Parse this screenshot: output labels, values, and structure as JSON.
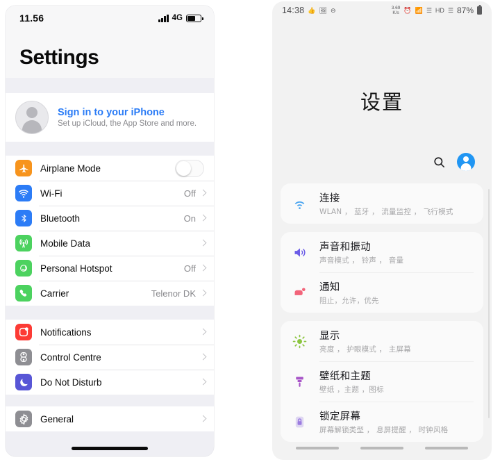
{
  "ios": {
    "status_bar": {
      "time": "11.56",
      "signal_icon": "cellular-signal-icon",
      "network_label": "4G",
      "battery_icon": "battery-icon"
    },
    "page_title": "Settings",
    "sign_in": {
      "avatar_icon": "account-avatar-icon",
      "title": "Sign in to your iPhone",
      "subtitle": "Set up iCloud, the App Store and more."
    },
    "groups": [
      {
        "items": [
          {
            "icon": "airplane-icon",
            "icon_color": "#f7941d",
            "label": "Airplane Mode",
            "value": "",
            "control": "toggle",
            "toggle_on": false
          },
          {
            "icon": "wifi-icon",
            "icon_color": "#2c7cf6",
            "label": "Wi-Fi",
            "value": "Off",
            "control": "chevron"
          },
          {
            "icon": "bluetooth-icon",
            "icon_color": "#2c7cf6",
            "label": "Bluetooth",
            "value": "On",
            "control": "chevron"
          },
          {
            "icon": "cellular-tower-icon",
            "icon_color": "#4cd25f",
            "label": "Mobile Data",
            "value": "",
            "control": "chevron"
          },
          {
            "icon": "hotspot-link-icon",
            "icon_color": "#4cd25f",
            "label": "Personal Hotspot",
            "value": "Off",
            "control": "chevron"
          },
          {
            "icon": "phone-handset-icon",
            "icon_color": "#4cd25f",
            "label": "Carrier",
            "value": "Telenor DK",
            "control": "chevron"
          }
        ]
      },
      {
        "items": [
          {
            "icon": "notifications-badge-icon",
            "icon_color": "#fc3b35",
            "label": "Notifications",
            "value": "",
            "control": "chevron"
          },
          {
            "icon": "control-centre-toggles-icon",
            "icon_color": "#8e8e93",
            "label": "Control Centre",
            "value": "",
            "control": "chevron"
          },
          {
            "icon": "moon-icon",
            "icon_color": "#5856d6",
            "label": "Do Not Disturb",
            "value": "",
            "control": "chevron"
          }
        ]
      },
      {
        "items": [
          {
            "icon": "gear-icon",
            "icon_color": "#8e8e93",
            "label": "General",
            "value": "",
            "control": "chevron"
          }
        ]
      }
    ],
    "home_indicator": "home-indicator"
  },
  "android": {
    "status_bar": {
      "time": "14:38",
      "left_icons": [
        "thumbs-up-icon",
        "image-icon",
        "do-not-disturb-icon"
      ],
      "data_rate": "3.69",
      "data_rate_unit": "K/s",
      "right_icons": [
        "alarm-clock-icon",
        "wifi-icon",
        "signal-4g-icon",
        "hd-voice-icon",
        "signal-4g-icon"
      ],
      "battery_percent": "87%",
      "battery_icon": "battery-icon"
    },
    "page_title": "设置",
    "actions": {
      "search_icon": "search-icon",
      "account_icon": "account-avatar-icon"
    },
    "cards": [
      {
        "items": [
          {
            "icon": "wifi-icon",
            "icon_color": "#4da6f0",
            "title": "连接",
            "subtitle": "WLAN ， 蓝牙 ， 流量监控 ， 飞行模式"
          }
        ]
      },
      {
        "items": [
          {
            "icon": "speaker-volume-icon",
            "icon_color": "#6b5ce7",
            "title": "声音和振动",
            "subtitle": "声音模式 ， 铃声 ， 音量"
          },
          {
            "icon": "notification-bubble-icon",
            "icon_color": "#f2647a",
            "title": "通知",
            "subtitle": "阻止，允许，优先"
          }
        ]
      },
      {
        "items": [
          {
            "icon": "brightness-sun-icon",
            "icon_color": "#8bc53f",
            "title": "显示",
            "subtitle": "亮度 ， 护眼模式 ， 主屏幕"
          },
          {
            "icon": "paint-roller-icon",
            "icon_color": "#a855c8",
            "title": "壁纸和主题",
            "subtitle": "壁纸 ，主题 ，图标"
          },
          {
            "icon": "lock-icon",
            "icon_color": "#9b7ce0",
            "title": "锁定屏幕",
            "subtitle": "屏幕解锁类型 ， 息屏提醒 ， 时钟风格"
          }
        ]
      }
    ],
    "nav_bar": [
      "nav-recents-pill",
      "nav-home-pill",
      "nav-back-pill"
    ],
    "scrollbar": "vertical-scrollbar"
  }
}
